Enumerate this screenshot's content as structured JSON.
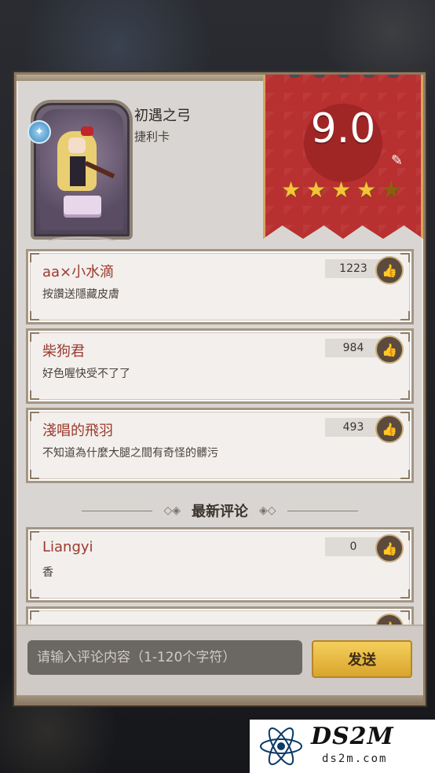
{
  "card": {
    "title": "初遇之弓",
    "subtitle": "捷利卡"
  },
  "score": {
    "value": "9.0",
    "stars_rating": 4.5,
    "stars_max": 5,
    "star_color": "#f3c43a",
    "banner_color": "#b8302f"
  },
  "top_comments": [
    {
      "user": "aa×小水滴",
      "text": "按讚送隱藏皮膚",
      "likes": "1223"
    },
    {
      "user": "柴狗君",
      "text": "好色喔快受不了了",
      "likes": "984"
    },
    {
      "user": "淺唱的飛羽",
      "text": "不知道為什麼大腿之間有奇怪的髒污",
      "likes": "493"
    }
  ],
  "latest_section": {
    "title": "最新评论"
  },
  "latest_comments": [
    {
      "user": "Liangyi",
      "text": "香",
      "likes": "0"
    }
  ],
  "input": {
    "placeholder": "请输入评论内容（1-120个字符）",
    "send_label": "发送"
  },
  "watermark": {
    "title": "DS2M",
    "subtitle": "ds2m.com"
  },
  "icons": {
    "like": "thumbs-up-icon",
    "edit": "pencil-icon",
    "card_type": "shield-icon"
  }
}
